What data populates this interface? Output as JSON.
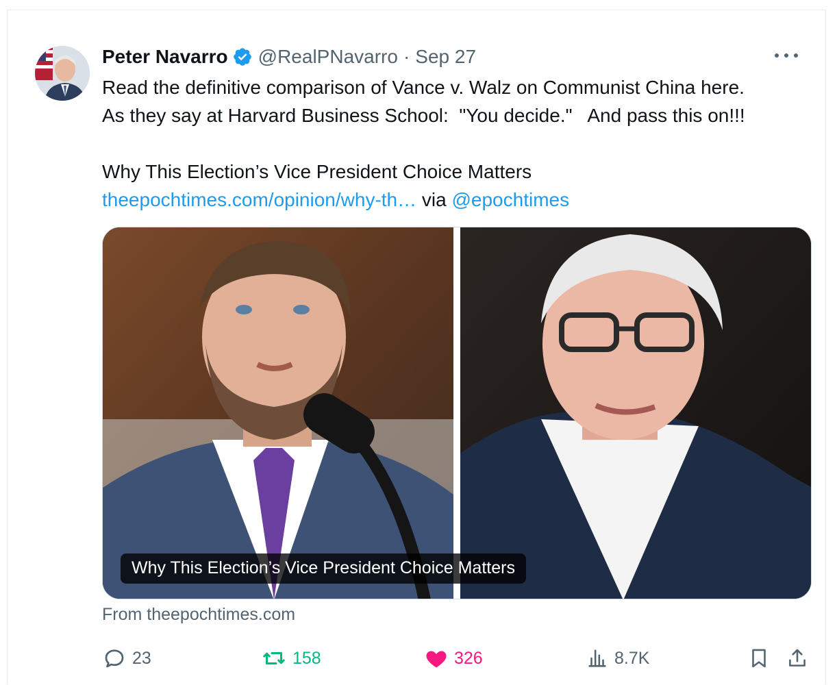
{
  "tweet": {
    "author_name": "Peter Navarro",
    "handle": "@RealPNavarro",
    "separator": "·",
    "date": "Sep 27",
    "text_line1": "Read the definitive comparison of Vance v. Walz on Communist China here.",
    "text_line2": "As they say at Harvard Business School:  \"You decide.\"   And pass this on!!!",
    "article_title": "Why This Election’s Vice President Choice Matters",
    "article_link": "theepochtimes.com/opinion/why-th…",
    "via_text": "via",
    "via_handle": "@epochtimes"
  },
  "card": {
    "caption": "Why This Election’s Vice President Choice Matters",
    "from_text": "From theepochtimes.com"
  },
  "actions": {
    "replies": "23",
    "retweets": "158",
    "likes": "326",
    "views": "8.7K"
  },
  "icons": {
    "verified": "verified-badge-icon",
    "more": "more-options-icon",
    "reply": "reply-icon",
    "retweet": "retweet-icon",
    "like": "heart-icon",
    "views": "views-chart-icon",
    "bookmark": "bookmark-icon",
    "share": "share-icon"
  },
  "colors": {
    "link": "#1d9bf0",
    "retweet": "#00ba7c",
    "like": "#f91880",
    "muted": "#536471"
  }
}
